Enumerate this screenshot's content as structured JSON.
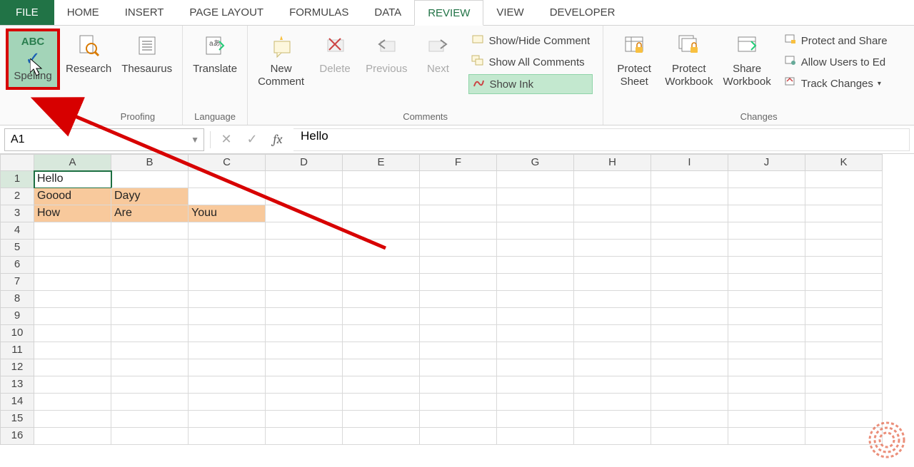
{
  "tabs": {
    "file": "FILE",
    "home": "HOME",
    "insert": "INSERT",
    "page_layout": "PAGE LAYOUT",
    "formulas": "FORMULAS",
    "data": "DATA",
    "review": "REVIEW",
    "view": "VIEW",
    "developer": "DEVELOPER"
  },
  "ribbon": {
    "proofing": {
      "spelling_abc": "ABC",
      "spelling": "Spelling",
      "research": "Research",
      "thesaurus": "Thesaurus",
      "group_label": "Proofing"
    },
    "language": {
      "translate": "Translate",
      "group_label": "Language"
    },
    "comments": {
      "new_comment": "New\nComment",
      "delete": "Delete",
      "previous": "Previous",
      "next": "Next",
      "show_hide": "Show/Hide Comment",
      "show_all": "Show All Comments",
      "show_ink": "Show Ink",
      "group_label": "Comments"
    },
    "changes": {
      "protect_sheet": "Protect\nSheet",
      "protect_workbook": "Protect\nWorkbook",
      "share_workbook": "Share\nWorkbook",
      "protect_share": "Protect and Share",
      "allow_users": "Allow Users to Ed",
      "track_changes": "Track Changes",
      "group_label": "Changes"
    }
  },
  "formula_bar": {
    "namebox": "A1",
    "value": "Hello"
  },
  "grid": {
    "columns": [
      "A",
      "B",
      "C",
      "D",
      "E",
      "F",
      "G",
      "H",
      "I",
      "J",
      "K"
    ],
    "rows": [
      "1",
      "2",
      "3",
      "4",
      "5",
      "6",
      "7",
      "8",
      "9",
      "10",
      "11",
      "12",
      "13",
      "14",
      "15",
      "16"
    ],
    "cells": {
      "A1": "Hello",
      "A2": "Goood",
      "B2": "Dayy",
      "A3": "How",
      "B3": "Are",
      "C3": "Youu"
    }
  }
}
